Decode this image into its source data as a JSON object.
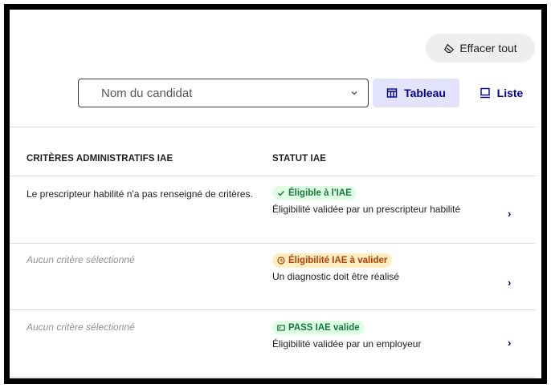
{
  "toolbar": {
    "clear_all_label": "Effacer tout",
    "search_placeholder": "Nom du candidat",
    "view_table_label": "Tableau",
    "view_list_label": "Liste"
  },
  "table": {
    "headers": [
      "CRITÈRES ADMINISTRATIFS IAE",
      "STATUT IAE"
    ],
    "rows": [
      {
        "criteria": "Le prescripteur habilité n'a pas renseigné de critères.",
        "criteria_empty": false,
        "badge": "Éligible à l'IAE",
        "badge_icon": "check-icon",
        "badge_color": "#18753c",
        "description": "Éligibilité validée par un prescripteur habilité",
        "action": "›"
      },
      {
        "criteria": "Aucun critère sélectionné",
        "criteria_empty": true,
        "badge": "Éligibilité IAE à valider",
        "badge_icon": "clock-icon",
        "badge_color": "#b34000",
        "description": "Un diagnostic doit être réalisé",
        "action": "›"
      },
      {
        "criteria": "Aucun critère sélectionné",
        "criteria_empty": true,
        "badge": "PASS IAE valide",
        "badge_icon": "pass-card-icon",
        "badge_color": "#18753c",
        "description": "Éligibilité validée par un employeur",
        "action": "›"
      }
    ]
  },
  "colors": {
    "primary": "#000091",
    "success": "#18753c",
    "warning": "#b34000",
    "muted": "#929292"
  }
}
